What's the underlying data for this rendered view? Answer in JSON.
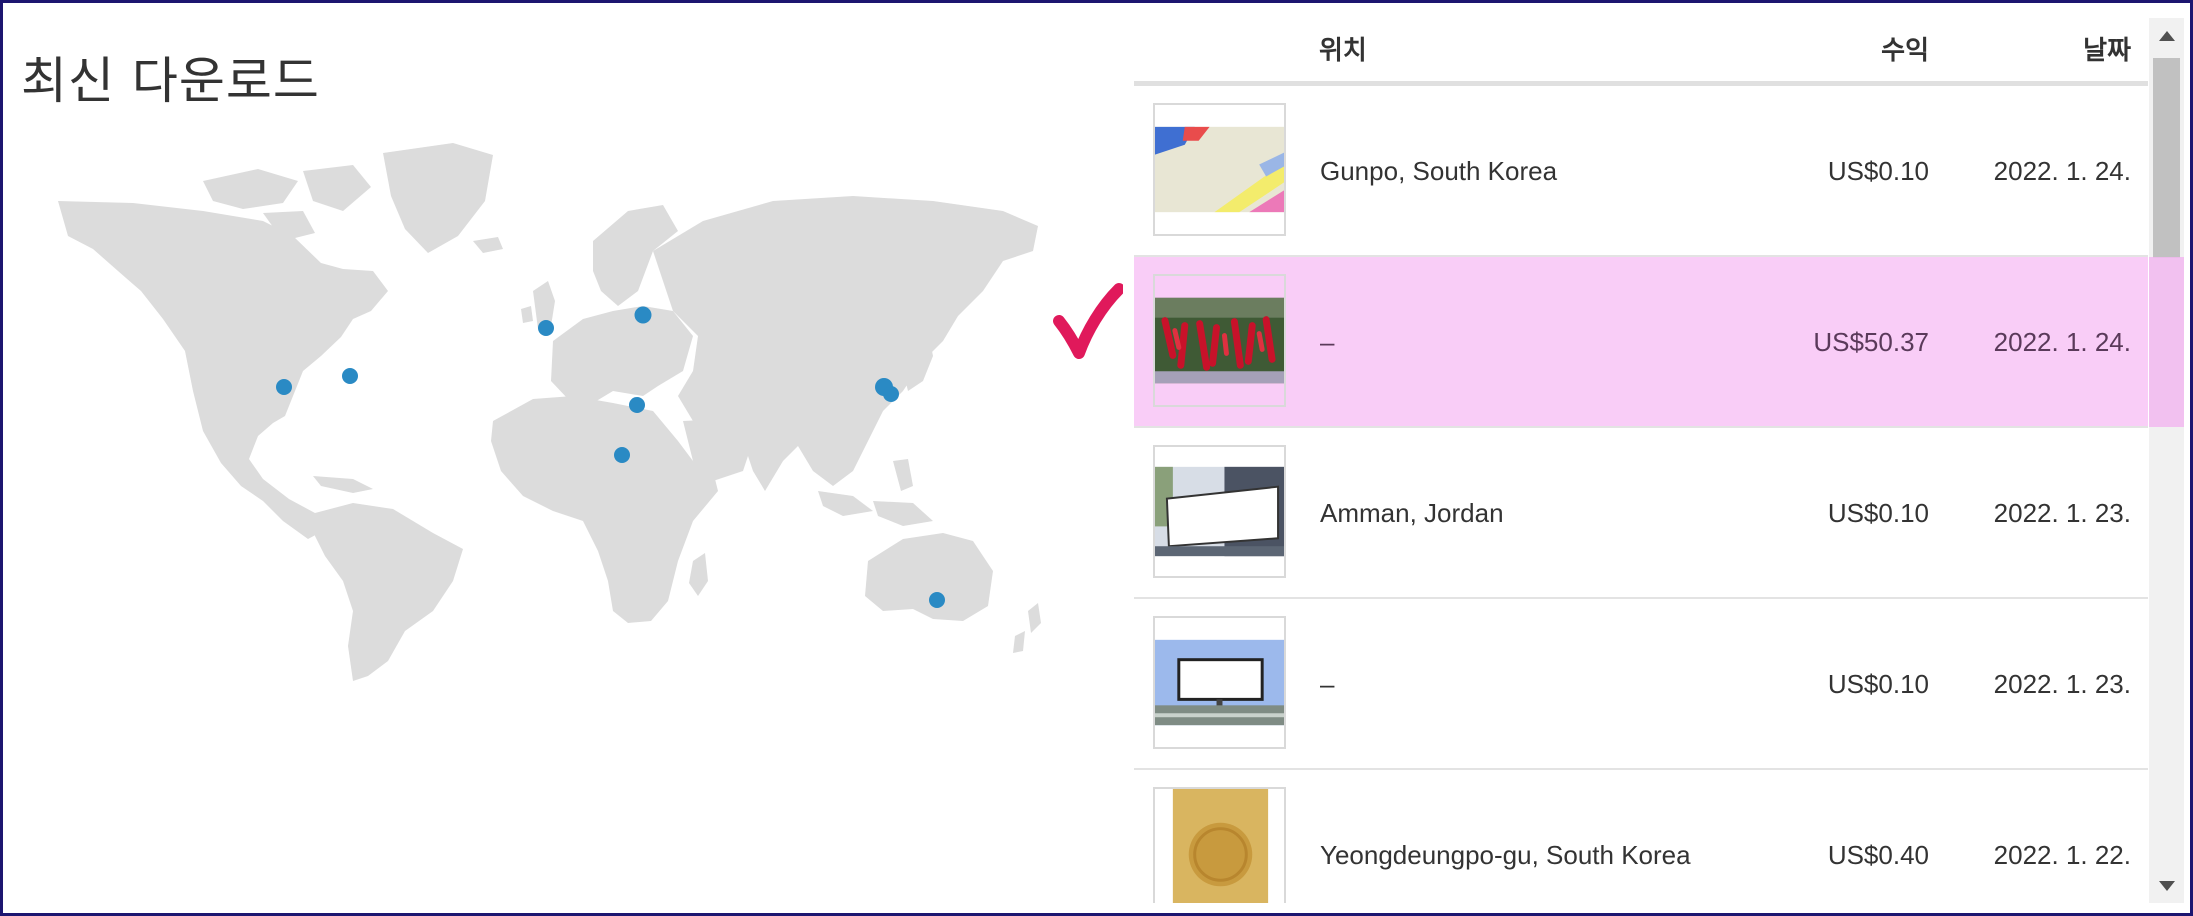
{
  "page": {
    "title": "최신 다운로드"
  },
  "table": {
    "headers": {
      "location": "위치",
      "revenue": "수익",
      "date": "날짜"
    },
    "rows": [
      {
        "location": "Gunpo, South Korea",
        "revenue": "US$0.10",
        "date": "2022. 1. 24.",
        "thumb": "colorful-paper-image",
        "selected": false
      },
      {
        "location": "–",
        "revenue": "US$50.37",
        "date": "2022. 1. 24.",
        "thumb": "red-pepper-field-image",
        "selected": true
      },
      {
        "location": "Amman, Jordan",
        "revenue": "US$0.10",
        "date": "2022. 1. 23.",
        "thumb": "billboard-building-image",
        "selected": false
      },
      {
        "location": "–",
        "revenue": "US$0.10",
        "date": "2022. 1. 23.",
        "thumb": "billboard-sky-image",
        "selected": false
      },
      {
        "location": "Yeongdeungpo-gu, South Korea",
        "revenue": "US$0.40",
        "date": "2022. 1. 22.",
        "thumb": "gold-coin-image",
        "selected": false
      }
    ]
  },
  "map": {
    "land_color": "#dcdcdc",
    "marker_color": "#2a8ac4",
    "markers": [
      "usa-central",
      "usa-east",
      "uk",
      "russia-moscow",
      "egypt",
      "sudan",
      "korea-seoul",
      "korea-south",
      "australia-sydney"
    ]
  },
  "colors": {
    "selected_row": "#f9cdf7",
    "checkmark": "#e0195b",
    "frame_border": "#1c1570"
  },
  "icons": {
    "checkmark": "checkmark-icon",
    "scroll_up": "arrow-up-icon",
    "scroll_down": "arrow-down-icon"
  }
}
